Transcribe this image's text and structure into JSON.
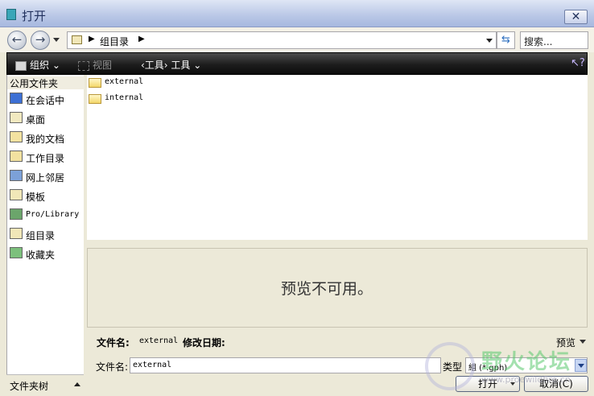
{
  "window": {
    "title": "打开",
    "close_label": "✕"
  },
  "nav": {
    "back_icon": "back-arrow-icon",
    "forward_icon": "forward-arrow-icon"
  },
  "address": {
    "segment": "组目录"
  },
  "search": {
    "placeholder": "搜索..."
  },
  "toolbar": {
    "organize": "组织 ⌄",
    "views": "视图",
    "tools": "‹工具› 工具 ⌄",
    "help_icon": "help-icon"
  },
  "sidebar": {
    "header": "公用文件夹",
    "items": [
      {
        "label": "在会话中",
        "icon": "monitor-icon",
        "color": "#3c6fd4"
      },
      {
        "label": "桌面",
        "icon": "desktop-icon",
        "color": "#f1e9c0"
      },
      {
        "label": "我的文档",
        "icon": "documents-icon",
        "color": "#f3e2a0"
      },
      {
        "label": "工作目录",
        "icon": "work-folder-icon",
        "color": "#f3e2a0"
      },
      {
        "label": "网上邻居",
        "icon": "network-icon",
        "color": "#7ca1d8"
      },
      {
        "label": "模板",
        "icon": "template-icon",
        "color": "#f1e7b8"
      },
      {
        "label": "Pro/Library",
        "icon": "library-icon",
        "color": "#6ba56b"
      },
      {
        "label": "组目录",
        "icon": "group-folder-icon",
        "color": "#f1e7b8"
      },
      {
        "label": "收藏夹",
        "icon": "favorites-icon",
        "color": "#7cc07c"
      }
    ],
    "folder_tree": "文件夹树"
  },
  "files": [
    {
      "name": "external",
      "icon": "folder-icon"
    },
    {
      "name": "internal",
      "icon": "folder-icon"
    }
  ],
  "preview": {
    "message": "预览不可用。",
    "toggle_label": "预览"
  },
  "info": {
    "filename_key": "文件名:",
    "filename_value": "external",
    "modified_key": "修改日期:"
  },
  "form": {
    "filename_label": "文件名:",
    "filename_value": "external",
    "type_label": "类型",
    "type_value": "組 (*.gph)"
  },
  "buttons": {
    "open": "打开",
    "cancel": "取消(C)"
  },
  "watermark": {
    "text": "野火论坛",
    "url": "www.proewildfire.cn"
  }
}
